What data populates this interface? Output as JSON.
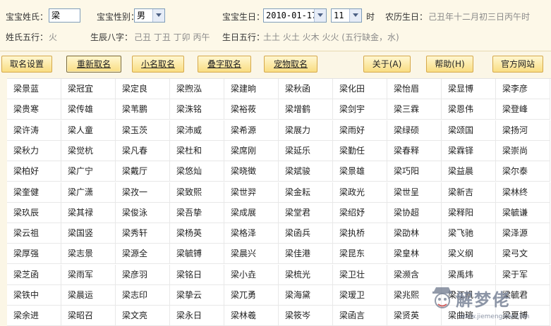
{
  "form": {
    "surname_label": "宝宝姓氏：",
    "surname_value": "梁",
    "gender_label": "宝宝性别：",
    "gender_value": "男",
    "birthday_label": "宝宝生日：",
    "birthday_value": "2010-01-17",
    "hour_value": "11",
    "hour_unit": "时",
    "lunar_label": "农历生日：",
    "lunar_value": "己丑年十二月初三日丙午时",
    "surname_wuxing_label": "姓氏五行：",
    "surname_wuxing_value": "火",
    "bazi_label": "生辰八字：",
    "bazi_value": "己丑  丁丑  丁卯  丙午",
    "birth_wuxing_label": "生日五行：",
    "birth_wuxing_value": "土土  火土  火木  火火 (五行缺金，水)"
  },
  "toolbar": {
    "buttons": [
      {
        "label": "取名设置"
      },
      {
        "label": "重新取名"
      },
      {
        "label": "小名取名"
      },
      {
        "label": "叠字取名"
      },
      {
        "label": "宠物取名"
      },
      {
        "label": "关于(A)"
      },
      {
        "label": "帮助(H)"
      },
      {
        "label": "官方网站"
      }
    ]
  },
  "names": [
    [
      "梁景蓝",
      "梁冠宜",
      "梁定良",
      "梁煦泓",
      "梁建晌",
      "梁秋函",
      "梁化田",
      "梁怡眉",
      "梁显博",
      "梁李彦"
    ],
    [
      "梁贵寒",
      "梁传雄",
      "梁苇鹏",
      "梁洙铭",
      "梁裕莜",
      "梁增鹤",
      "梁剑宇",
      "梁三霖",
      "梁恩伟",
      "梁登峰"
    ],
    [
      "梁许涛",
      "梁人童",
      "梁玉茨",
      "梁沛威",
      "梁希源",
      "梁展力",
      "梁雨好",
      "梁绿硕",
      "梁颂国",
      "梁扬河"
    ],
    [
      "梁秋力",
      "梁觉杭",
      "梁凡春",
      "梁杜和",
      "梁席刚",
      "梁延乐",
      "梁勤任",
      "梁春释",
      "梁霖铎",
      "梁崇尚"
    ],
    [
      "梁柏好",
      "梁广宁",
      "梁戴厅",
      "梁悠灿",
      "梁晓徵",
      "梁斌骏",
      "梁景雄",
      "梁巧阳",
      "梁益晨",
      "梁尔泰"
    ],
    [
      "梁奎健",
      "梁广潇",
      "梁孜一",
      "梁致熙",
      "梁世羿",
      "梁金耘",
      "梁政光",
      "梁世呈",
      "梁新吉",
      "梁林终"
    ],
    [
      "梁玖辰",
      "梁其禄",
      "梁俊泳",
      "梁吾挚",
      "梁成展",
      "梁堂君",
      "梁绍妤",
      "梁协超",
      "梁释阳",
      "梁毓谦"
    ],
    [
      "梁云祖",
      "梁国竖",
      "梁秀轩",
      "梁杨英",
      "梁格泽",
      "梁函兵",
      "梁执桥",
      "梁劭林",
      "梁飞驰",
      "梁泽源"
    ],
    [
      "梁厚强",
      "梁志景",
      "梁源全",
      "梁毓镈",
      "梁晨兴",
      "梁佳港",
      "梁昆东",
      "梁皇林",
      "梁义纲",
      "梁弓文"
    ],
    [
      "梁芝函",
      "梁雨军",
      "梁彦羽",
      "梁铭日",
      "梁小垚",
      "梁梳光",
      "梁卫壮",
      "梁濒含",
      "梁禹炜",
      "梁于军"
    ],
    [
      "梁铁中",
      "梁晨运",
      "梁志印",
      "梁挚云",
      "梁兀勇",
      "梁海黛",
      "梁瑷卫",
      "梁兆熙",
      "梁江帆",
      "梁毓君"
    ],
    [
      "梁余进",
      "梁昭召",
      "梁文亮",
      "梁永日",
      "梁林羲",
      "梁筱岑",
      "梁函言",
      "梁贤英",
      "梁曲瑄",
      "梁夏博"
    ]
  ],
  "watermark": {
    "text": "解梦佬",
    "url": "www.jiemengzhe.com"
  },
  "colors": {
    "button_top": "#fff7d1",
    "button_bottom": "#f9dd82",
    "button_border": "#d5a84a",
    "form_bg": "#fdf8e8"
  }
}
